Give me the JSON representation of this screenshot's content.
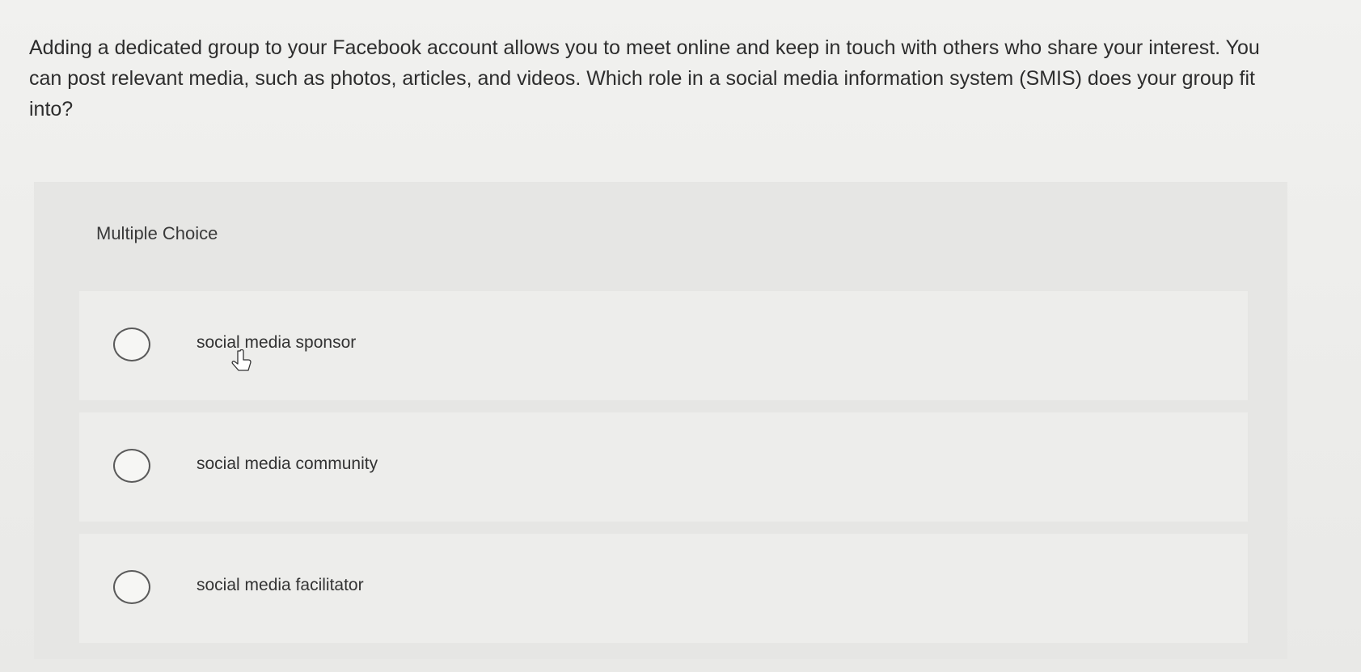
{
  "question": {
    "text": "Adding a dedicated group to your Facebook account allows you to meet online and keep in touch with others who share your interest. You can post relevant media, such as photos, articles, and videos. Which role in a social media information system (SMIS) does your group fit into?"
  },
  "multiple_choice": {
    "label": "Multiple Choice",
    "options": [
      {
        "label": "social media sponsor",
        "selected": false
      },
      {
        "label": "social media community",
        "selected": false
      },
      {
        "label": "social media facilitator",
        "selected": false
      }
    ]
  },
  "icons": {
    "cursor": "hand-pointer-icon",
    "radio": "radio-button-icon"
  }
}
